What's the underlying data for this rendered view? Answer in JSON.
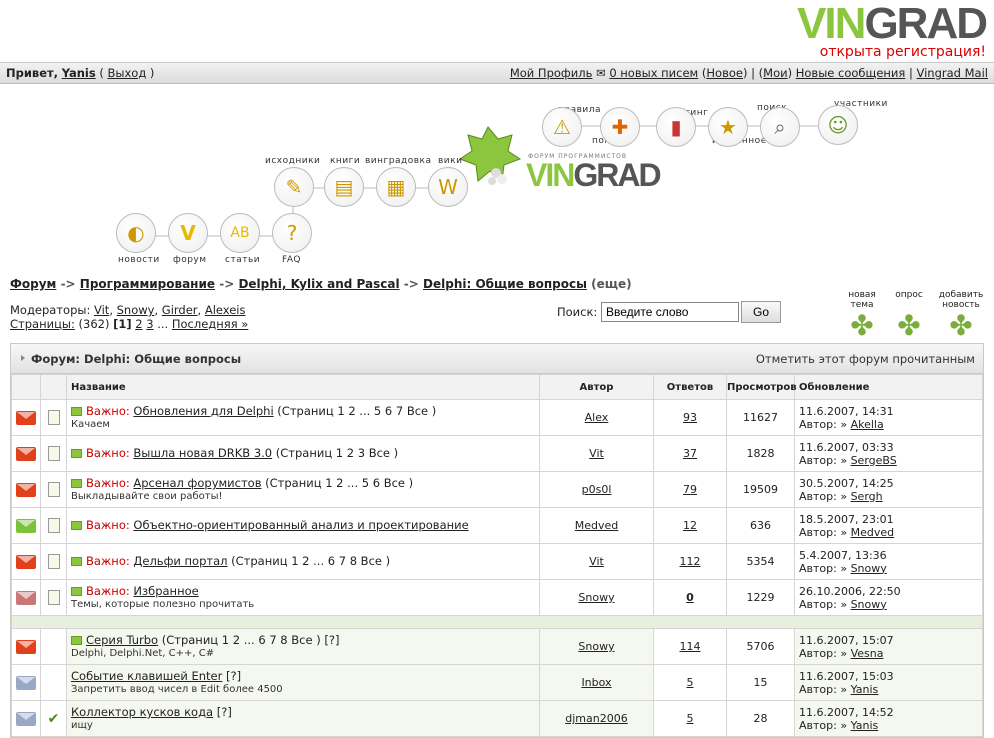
{
  "brand": {
    "logo": "VINGRAD",
    "tagline": "открыта регистрация!"
  },
  "userbar": {
    "greeting": "Привет,",
    "username": "Yanis",
    "logout": "Выход",
    "profile": "Мой Профиль",
    "mail": "0 новых писем",
    "new": "Новое",
    "mine": "Мои",
    "new_msgs": "Новые сообщения",
    "vmail": "Vingrad Mail"
  },
  "nav": {
    "rules": "правила",
    "help": "помощь",
    "rating": "рейтинг",
    "search": "поиск",
    "favorites": "избранное",
    "members": "участники",
    "sources": "исходники",
    "books": "книги",
    "vingradovka": "винградовка",
    "wiki": "вики",
    "news": "новости",
    "forum": "форум",
    "articles": "статьи",
    "faq": "FAQ",
    "center_logo": "VINGRAD",
    "center_sub": "ФОРУМ ПРОГРАММИСТОВ"
  },
  "breadcrumb": {
    "c1": "Форум",
    "c2": "Программирование",
    "c3": "Delphi, Kylix and Pascal",
    "c4": "Delphi: Общие вопросы",
    "more": "(еще)",
    "sep": "->"
  },
  "moderators": {
    "label": "Модераторы:",
    "list": [
      "Vit",
      "Snowy",
      "Girder",
      "Alexeis"
    ]
  },
  "pages": {
    "label": "Страницы:",
    "count": "(362)",
    "current": "[1]",
    "p2": "2",
    "p3": "3",
    "dots": "...",
    "last": "Последняя »"
  },
  "search": {
    "label": "Поиск:",
    "placeholder": "Введите слово",
    "go": "Go"
  },
  "actions": {
    "new_topic": "новая\nтема",
    "poll": "опрос",
    "add_news": "добавить\nновость"
  },
  "forum": {
    "title": "Форум: Delphi: Общие вопросы",
    "mark_read": "Отметить этот форум прочитанным"
  },
  "columns": {
    "name": "Название",
    "author": "Автор",
    "replies": "Ответов",
    "views": "Просмотров",
    "updated": "Обновление"
  },
  "topics": [
    {
      "important": true,
      "prefix": "Важно: ",
      "title": "Обновления для Delphi",
      "pages": " (Страниц 1 2 ... 5 6 7 Все )",
      "sub": "Качаем",
      "author": "Alex",
      "replies": "93",
      "views": "11627",
      "date": "11.6.2007, 14:31",
      "last": "Akella",
      "env": "#e0401a"
    },
    {
      "important": true,
      "prefix": "Важно: ",
      "title": "Вышла новая DRKB 3.0",
      "pages": " (Страниц 1 2 3 Все )",
      "sub": "",
      "author": "Vit",
      "replies": "37",
      "views": "1828",
      "date": "11.6.2007, 03:33",
      "last": "SergeBS",
      "env": "#e0401a"
    },
    {
      "important": true,
      "prefix": "Важно: ",
      "title": "Арсенал форумистов",
      "pages": " (Страниц 1 2 ... 5 6 Все )",
      "sub": "Выкладывайте свои работы!",
      "author": "p0s0l",
      "replies": "79",
      "views": "19509",
      "date": "30.5.2007, 14:25",
      "last": "Sergh",
      "env": "#e0401a"
    },
    {
      "important": true,
      "prefix": "Важно: ",
      "title": "Объектно-ориентированный анализ и проектирование",
      "pages": "",
      "sub": "",
      "author": "Medved",
      "replies": "12",
      "views": "636",
      "date": "18.5.2007, 23:01",
      "last": "Medved",
      "env": "#7cc23a"
    },
    {
      "important": true,
      "prefix": "Важно: ",
      "title": "Дельфи портал",
      "pages": " (Страниц 1 2 ... 6 7 8 Все )",
      "sub": "",
      "author": "Vit",
      "replies": "112",
      "views": "5354",
      "date": "5.4.2007, 13:36",
      "last": "Snowy",
      "env": "#e0401a"
    },
    {
      "important": true,
      "prefix": "Важно: ",
      "title": "Избранное",
      "pages": "",
      "sub": "Темы, которые полезно прочитать",
      "author": "Snowy",
      "replies": "0",
      "views": "1229",
      "date": "26.10.2006, 22:50",
      "last": "Snowy",
      "env": "#cc7777"
    },
    {
      "important": false,
      "prefix": "",
      "title": "Серия Turbo",
      "pages": " (Страниц 1 2 ... 6 7 8 Все ) [?]",
      "sub": "Delphi, Delphi.Net, C++, C#",
      "author": "Snowy",
      "replies": "114",
      "views": "5706",
      "date": "11.6.2007, 15:07",
      "last": "Vesna",
      "env": "#e0401a"
    },
    {
      "important": false,
      "prefix": "",
      "title": "Событие клавишей Enter",
      "pages": " [?]",
      "sub": "Запретить ввод чисел в Edit более 4500",
      "author": "Inbox",
      "replies": "5",
      "views": "15",
      "date": "11.6.2007, 15:03",
      "last": "Yanis",
      "env": "#9aa8c8"
    },
    {
      "important": false,
      "prefix": "",
      "title": "Коллектор кусков кода",
      "pages": " [?]",
      "sub": "ищу",
      "author": "djman2006",
      "replies": "5",
      "views": "28",
      "date": "11.6.2007, 14:52",
      "last": "Yanis",
      "env": "#9aa8c8"
    }
  ],
  "last_by": "Автор:",
  "arrow": "»"
}
